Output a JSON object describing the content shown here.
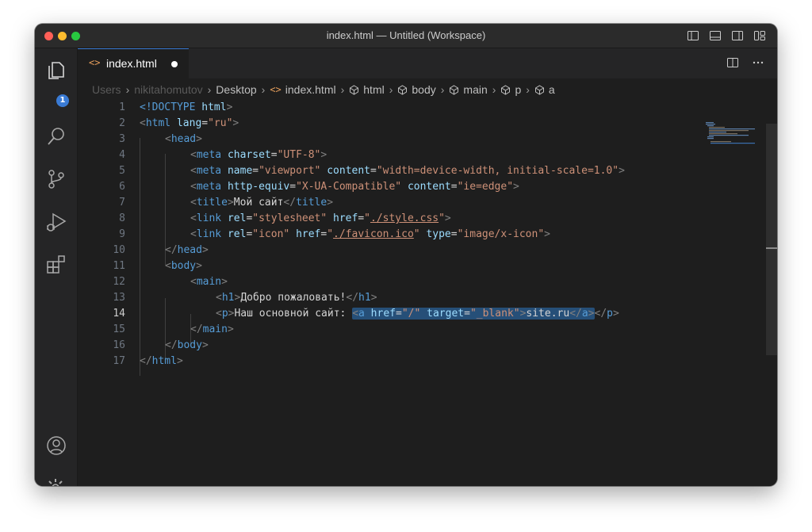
{
  "window": {
    "title": "index.html — Untitled (Workspace)"
  },
  "activity_bar": {
    "explorer_badge": "1"
  },
  "tab": {
    "label": "index.html"
  },
  "breadcrumb": [
    "Users",
    "nikitahomutov",
    "Desktop",
    "index.html",
    "html",
    "body",
    "main",
    "p",
    "a"
  ],
  "editor": {
    "current_line": 14,
    "lines": [
      {
        "n": "1"
      },
      {
        "n": "2"
      },
      {
        "n": "3"
      },
      {
        "n": "4"
      },
      {
        "n": "5"
      },
      {
        "n": "6"
      },
      {
        "n": "7"
      },
      {
        "n": "8"
      },
      {
        "n": "9"
      },
      {
        "n": "10"
      },
      {
        "n": "11"
      },
      {
        "n": "12"
      },
      {
        "n": "13"
      },
      {
        "n": "14"
      },
      {
        "n": "15"
      },
      {
        "n": "16"
      },
      {
        "n": "17"
      }
    ],
    "code": {
      "l1": [
        "<!DOCTYPE ",
        "html",
        ">"
      ],
      "l2": [
        "<",
        "html",
        " lang",
        "=",
        "\"ru\"",
        ">"
      ],
      "l3": [
        "<",
        "head",
        ">"
      ],
      "l4": [
        "<",
        "meta",
        " charset",
        "=",
        "\"UTF-8\"",
        ">"
      ],
      "l5": [
        "<",
        "meta",
        " name",
        "=",
        "\"viewport\"",
        " content",
        "=",
        "\"width=device-width, initial-scale=1.0\"",
        ">"
      ],
      "l6": [
        "<",
        "meta",
        " http-equiv",
        "=",
        "\"X-UA-Compatible\"",
        " content",
        "=",
        "\"ie=edge\"",
        ">"
      ],
      "l7": [
        "<",
        "title",
        ">",
        "Мой сайт",
        "</",
        "title",
        ">"
      ],
      "l8": [
        "<",
        "link",
        " rel",
        "=",
        "\"stylesheet\"",
        " href",
        "=",
        "\"",
        "./style.css",
        "\"",
        ">"
      ],
      "l9": [
        "<",
        "link",
        " rel",
        "=",
        "\"icon\"",
        " href",
        "=",
        "\"",
        "./favicon.ico",
        "\"",
        " type",
        "=",
        "\"image/x-icon\"",
        ">"
      ],
      "l10": [
        "</",
        "head",
        ">"
      ],
      "l11": [
        "<",
        "body",
        ">"
      ],
      "l12": [
        "<",
        "main",
        ">"
      ],
      "l13": [
        "<",
        "h1",
        ">",
        "Добро пожаловать!",
        "</",
        "h1",
        ">"
      ],
      "l14": [
        "<",
        "p",
        ">",
        "Наш основной сайт: ",
        "<",
        "a",
        " href",
        "=",
        "\"/\"",
        " target",
        "=",
        "\"_blank\"",
        ">",
        "site.ru",
        "</",
        "a",
        ">",
        "</",
        "p",
        ">"
      ],
      "l15": [
        "</",
        "main",
        ">"
      ],
      "l16": [
        "</",
        "body",
        ">"
      ],
      "l17": [
        "</",
        "html",
        ">"
      ]
    }
  },
  "icons": {
    "explorer": "files-icon",
    "search": "search-icon",
    "scm": "source-control-icon",
    "debug": "run-debug-icon",
    "extensions": "extensions-icon",
    "account": "account-icon",
    "settings": "settings-gear-icon"
  },
  "colors": {
    "accent": "#3a7bd5",
    "background": "#1e1e1e",
    "tag": "#569cd6",
    "attribute": "#9cdcfe",
    "string": "#ce9178",
    "selection": "#264f78"
  }
}
